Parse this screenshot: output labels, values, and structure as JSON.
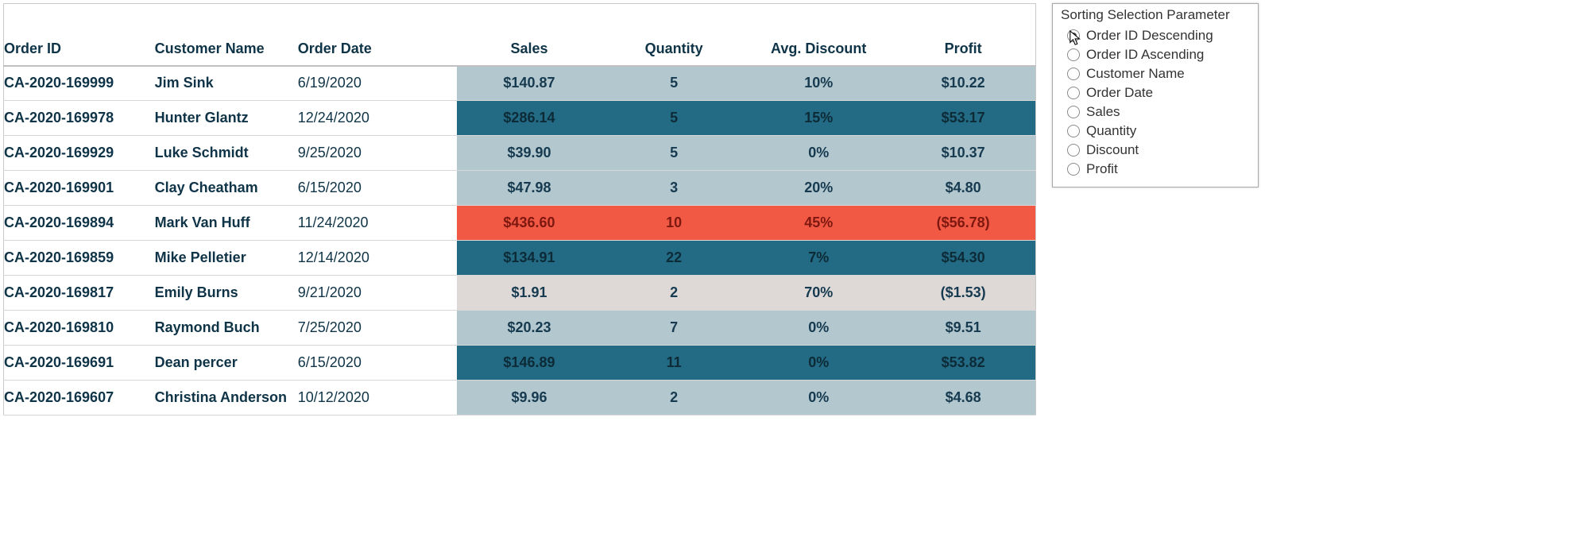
{
  "columns": {
    "order_id": "Order ID",
    "customer": "Customer Name",
    "date": "Order Date",
    "sales": "Sales",
    "quantity": "Quantity",
    "discount": "Avg. Discount",
    "profit": "Profit"
  },
  "rows": [
    {
      "order_id": "CA-2020-169999",
      "customer": "Jim Sink",
      "date": "6/19/2020",
      "sales": "$140.87",
      "quantity": "5",
      "discount": "10%",
      "profit": "$10.22",
      "style": "light"
    },
    {
      "order_id": "CA-2020-169978",
      "customer": "Hunter Glantz",
      "date": "12/24/2020",
      "sales": "$286.14",
      "quantity": "5",
      "discount": "15%",
      "profit": "$53.17",
      "style": "dark"
    },
    {
      "order_id": "CA-2020-169929",
      "customer": "Luke Schmidt",
      "date": "9/25/2020",
      "sales": "$39.90",
      "quantity": "5",
      "discount": "0%",
      "profit": "$10.37",
      "style": "light"
    },
    {
      "order_id": "CA-2020-169901",
      "customer": "Clay Cheatham",
      "date": "6/15/2020",
      "sales": "$47.98",
      "quantity": "3",
      "discount": "20%",
      "profit": "$4.80",
      "style": "light"
    },
    {
      "order_id": "CA-2020-169894",
      "customer": "Mark Van Huff",
      "date": "11/24/2020",
      "sales": "$436.60",
      "quantity": "10",
      "discount": "45%",
      "profit": "($56.78)",
      "style": "red"
    },
    {
      "order_id": "CA-2020-169859",
      "customer": "Mike Pelletier",
      "date": "12/14/2020",
      "sales": "$134.91",
      "quantity": "22",
      "discount": "7%",
      "profit": "$54.30",
      "style": "dark"
    },
    {
      "order_id": "CA-2020-169817",
      "customer": "Emily Burns",
      "date": "9/21/2020",
      "sales": "$1.91",
      "quantity": "2",
      "discount": "70%",
      "profit": "($1.53)",
      "style": "grey"
    },
    {
      "order_id": "CA-2020-169810",
      "customer": "Raymond Buch",
      "date": "7/25/2020",
      "sales": "$20.23",
      "quantity": "7",
      "discount": "0%",
      "profit": "$9.51",
      "style": "light"
    },
    {
      "order_id": "CA-2020-169691",
      "customer": "Dean percer",
      "date": "6/15/2020",
      "sales": "$146.89",
      "quantity": "11",
      "discount": "0%",
      "profit": "$53.82",
      "style": "dark"
    },
    {
      "order_id": "CA-2020-169607",
      "customer": "Christina Anderson",
      "date": "10/12/2020",
      "sales": "$9.96",
      "quantity": "2",
      "discount": "0%",
      "profit": "$4.68",
      "style": "light"
    }
  ],
  "panel": {
    "title": "Sorting Selection Parameter",
    "options": [
      "Order ID Descending",
      "Order ID Ascending",
      "Customer Name",
      "Order Date",
      "Sales",
      "Quantity",
      "Discount",
      "Profit"
    ],
    "selected_index": 0
  }
}
